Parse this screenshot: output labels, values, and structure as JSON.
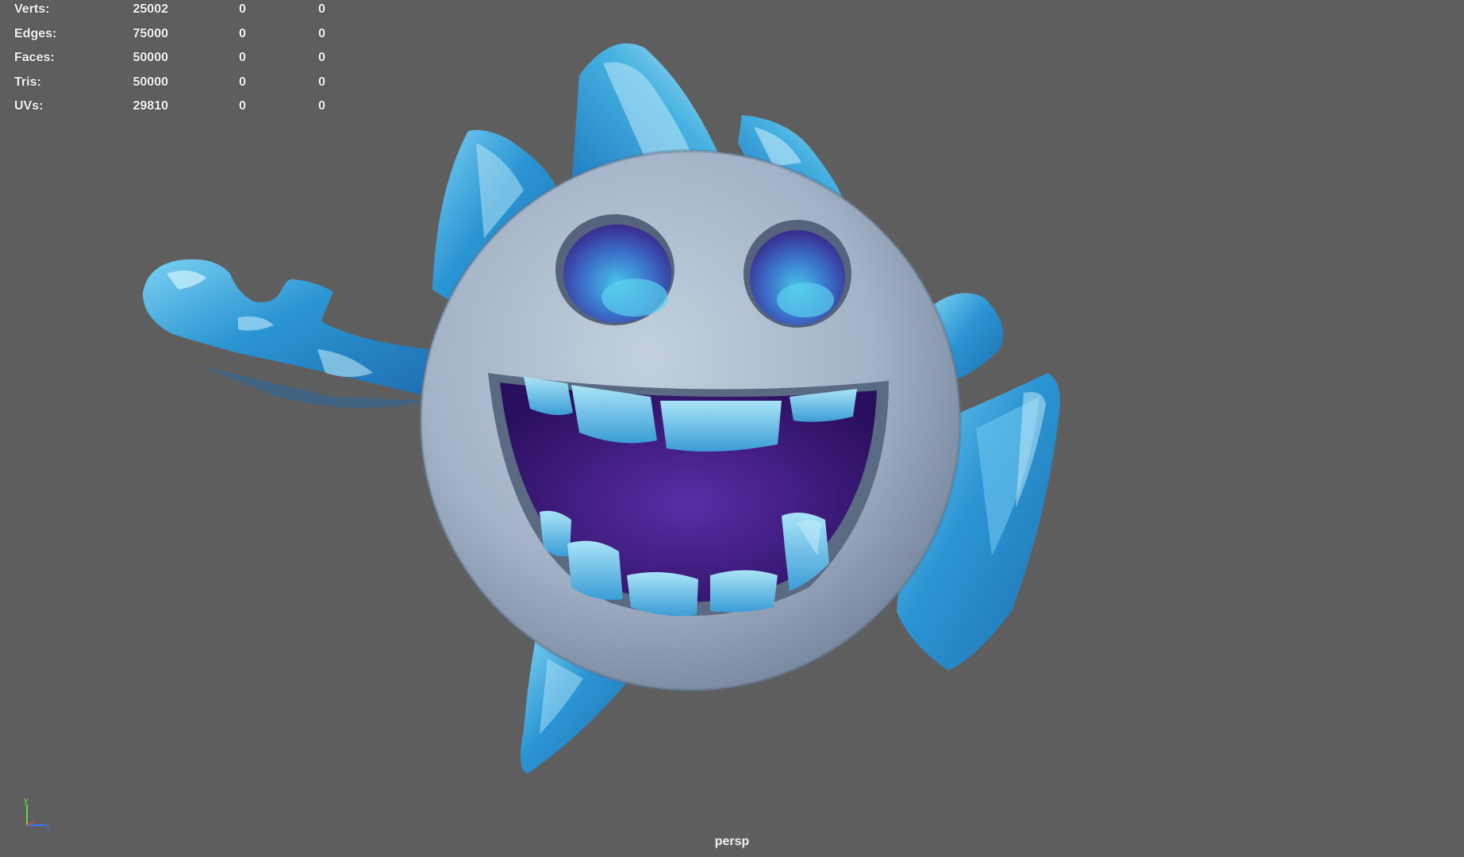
{
  "hud": {
    "rows": [
      {
        "label": "Verts:",
        "v1": "25002",
        "v2": "0",
        "v3": "0"
      },
      {
        "label": "Edges:",
        "v1": "75000",
        "v2": "0",
        "v3": "0"
      },
      {
        "label": "Faces:",
        "v1": "50000",
        "v2": "0",
        "v3": "0"
      },
      {
        "label": "Tris:",
        "v1": "50000",
        "v2": "0",
        "v3": "0"
      },
      {
        "label": "UVs:",
        "v1": "29810",
        "v2": "0",
        "v3": "0"
      }
    ]
  },
  "gizmo": {
    "y_label": "y",
    "z_label": "z"
  },
  "viewport": {
    "camera": "persp",
    "background": "#5e5e5e"
  },
  "colors": {
    "head": "#a6b5c8",
    "head_shadow": "#6b7c93",
    "ice": "#2f97d3",
    "ice_light": "#b9e6f7",
    "mouth": "#3d1a7a",
    "eye": "#4a3fb0"
  }
}
